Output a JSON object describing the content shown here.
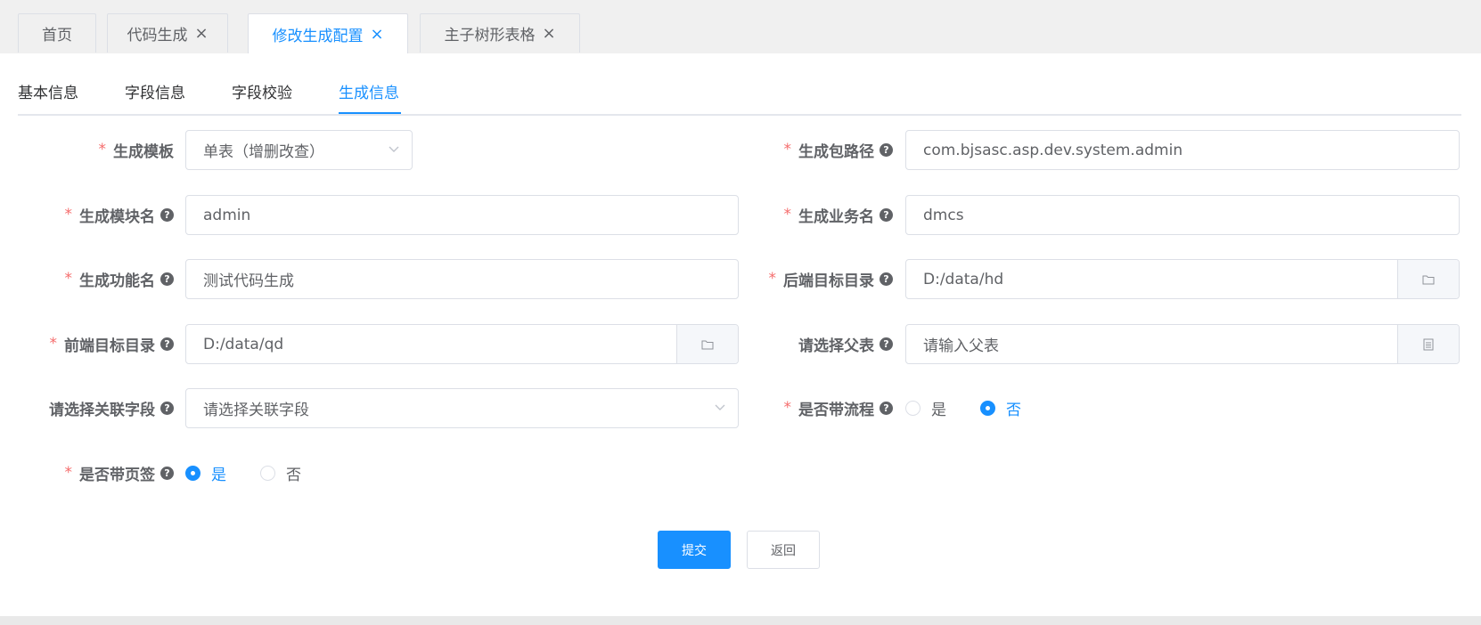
{
  "top_tabs": [
    {
      "label": "首页",
      "closable": false
    },
    {
      "label": "代码生成",
      "closable": true
    },
    {
      "label": "修改生成配置",
      "closable": true,
      "active": true
    },
    {
      "label": "主子树形表格",
      "closable": true
    }
  ],
  "close_glyph": "×",
  "sub_tabs": [
    {
      "label": "基本信息"
    },
    {
      "label": "字段信息"
    },
    {
      "label": "字段校验"
    },
    {
      "label": "生成信息",
      "active": true
    }
  ],
  "form": {
    "required_mark": "*",
    "help_glyph": "?",
    "tpl_category": {
      "label": "生成模板",
      "value": "单表（增删改查）"
    },
    "package_name": {
      "label": "生成包路径",
      "value": "com.bjsasc.asp.dev.system.admin"
    },
    "module_name": {
      "label": "生成模块名",
      "value": "admin"
    },
    "business_name": {
      "label": "生成业务名",
      "value": "dmcs"
    },
    "function_name": {
      "label": "生成功能名",
      "value": "测试代码生成"
    },
    "backend_path": {
      "label": "后端目标目录",
      "value": "D:/data/hd"
    },
    "frontend_path": {
      "label": "前端目标目录",
      "value": "D:/data/qd"
    },
    "parent_table": {
      "label": "请选择父表",
      "placeholder": "请输入父表"
    },
    "relation_field": {
      "label": "请选择关联字段",
      "placeholder": "请选择关联字段"
    },
    "with_flow": {
      "label": "是否带流程",
      "options": [
        "是",
        "否"
      ],
      "selected": "否"
    },
    "with_tabs": {
      "label": "是否带页签",
      "options": [
        "是",
        "否"
      ],
      "selected": "是"
    }
  },
  "buttons": {
    "submit": "提交",
    "back": "返回"
  },
  "colors": {
    "accent": "#1890ff",
    "required": "#f56c6c"
  }
}
